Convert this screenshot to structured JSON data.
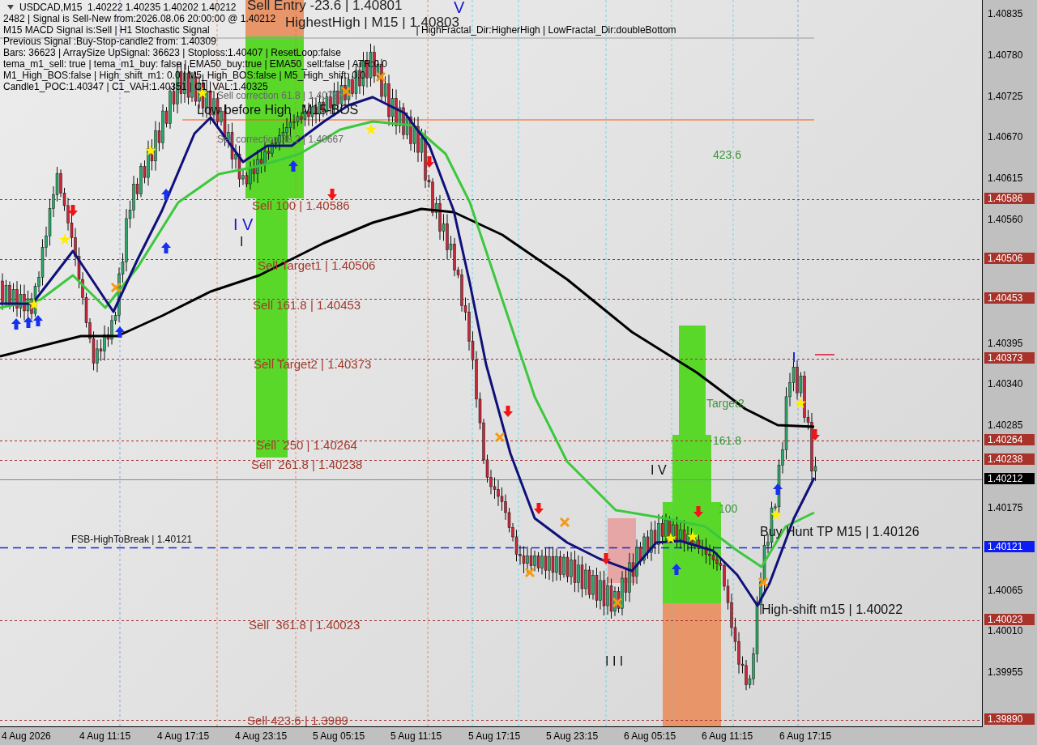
{
  "info_lines": [
    [
      "USDCAD,M15  1.40222 1.40235 1.40202 1.40212"
    ],
    [
      "2482 | Signal is Sell-New from:2026.08.06 20:00:00 @ 1.40212"
    ],
    [
      "M15 MACD Signal is:Sell | H1 Stochastic Signal",
      "| HighFractal_Dir:HigherHigh | LowFractal_Dir:doubleBottom"
    ],
    [
      "Previous Signal :Buy-Stop-candle2 from: 1.40309"
    ],
    [
      "Bars: 36623 | ArraySize UpSignal: 36623 | Stoploss:1.40407 | ResetLoop:false"
    ],
    [
      "tema_m1_sell: true | tema_m1_buy: false | EMA50_buy:true | EMA50_sell:false | ATR:0.0"
    ],
    [
      "M1_High_BOS:false | High_shift_m1: 0.0 | M5_High_BOS:false | M5_High_shift: 0.0"
    ],
    [
      "Candle1_POC:1.40347 | C1_VAH:1.40351 | C1_VAL:1.40325"
    ]
  ],
  "chart_labels": [
    {
      "text": "Sell Entry -23.6 | 1.40801",
      "kind": "big"
    },
    {
      "text": "HighestHigh | M15 | 1.40803",
      "kind": "big"
    },
    {
      "text": "Sell correction 61.8 | 1.40720",
      "kind": "correction"
    },
    {
      "text": "Low before High",
      "kind": "note"
    },
    {
      "text": "M15-BOS",
      "kind": "note"
    },
    {
      "text": "Sell correction 38.2 | 1.40667",
      "kind": "correction"
    },
    {
      "text": "Sell 100 | 1.40586",
      "kind": "sell"
    },
    {
      "text": "Sell Target1 | 1.40506",
      "kind": "sell"
    },
    {
      "text": "I V",
      "kind": "wave"
    },
    {
      "text": "I",
      "kind": "note"
    },
    {
      "text": "Sell 161.8 | 1.40453",
      "kind": "sell"
    },
    {
      "text": "Sell Target2 | 1.40373",
      "kind": "sell"
    },
    {
      "text": "Sell  250 | 1.40264",
      "kind": "sell"
    },
    {
      "text": "Sell  261.8 | 1.40238",
      "kind": "sell"
    },
    {
      "text": "FSB-HighToBreak | 1.40121",
      "kind": "small"
    },
    {
      "text": "Sell  361.8 | 1.40023",
      "kind": "sell"
    },
    {
      "text": "Sell 423.6 | 1.3989",
      "kind": "sell"
    },
    {
      "text": "V",
      "kind": "wave"
    },
    {
      "text": "423.6",
      "kind": "fib"
    },
    {
      "text": "Target2",
      "kind": "fib"
    },
    {
      "text": "161.8",
      "kind": "fib"
    },
    {
      "text": "100",
      "kind": "fib"
    },
    {
      "text": "I V",
      "kind": "note"
    },
    {
      "text": "Buy Hunt TP M15 | 1.40126",
      "kind": "note"
    },
    {
      "text": "High-shift m15 | 1.40022",
      "kind": "note"
    },
    {
      "text": "I I I",
      "kind": "note"
    }
  ],
  "price_axis": {
    "ticks": [
      "1.40835",
      "1.40780",
      "1.40725",
      "1.40670",
      "1.40615",
      "1.40560",
      "1.40395",
      "1.40340",
      "1.40285",
      "1.40175",
      "1.40065",
      "1.40010",
      "1.39955"
    ],
    "levels": [
      {
        "text": "1.40586",
        "kind": "sell"
      },
      {
        "text": "1.40506",
        "kind": "sell"
      },
      {
        "text": "1.40453",
        "kind": "sell"
      },
      {
        "text": "1.40373",
        "kind": "sell"
      },
      {
        "text": "1.40264",
        "kind": "sell"
      },
      {
        "text": "1.40238",
        "kind": "sell"
      },
      {
        "text": "1.40212",
        "kind": "current"
      },
      {
        "text": "1.40121",
        "kind": "line"
      },
      {
        "text": "1.40023",
        "kind": "sell"
      },
      {
        "text": "1.39890",
        "kind": "sell"
      }
    ]
  },
  "time_axis": [
    "4 Aug 2026",
    "4 Aug 11:15",
    "4 Aug 17:15",
    "4 Aug 23:15",
    "5 Aug 05:15",
    "5 Aug 11:15",
    "5 Aug 17:15",
    "5 Aug 23:15",
    "6 Aug 05:15",
    "6 Aug 11:15",
    "6 Aug 17:15"
  ]
}
